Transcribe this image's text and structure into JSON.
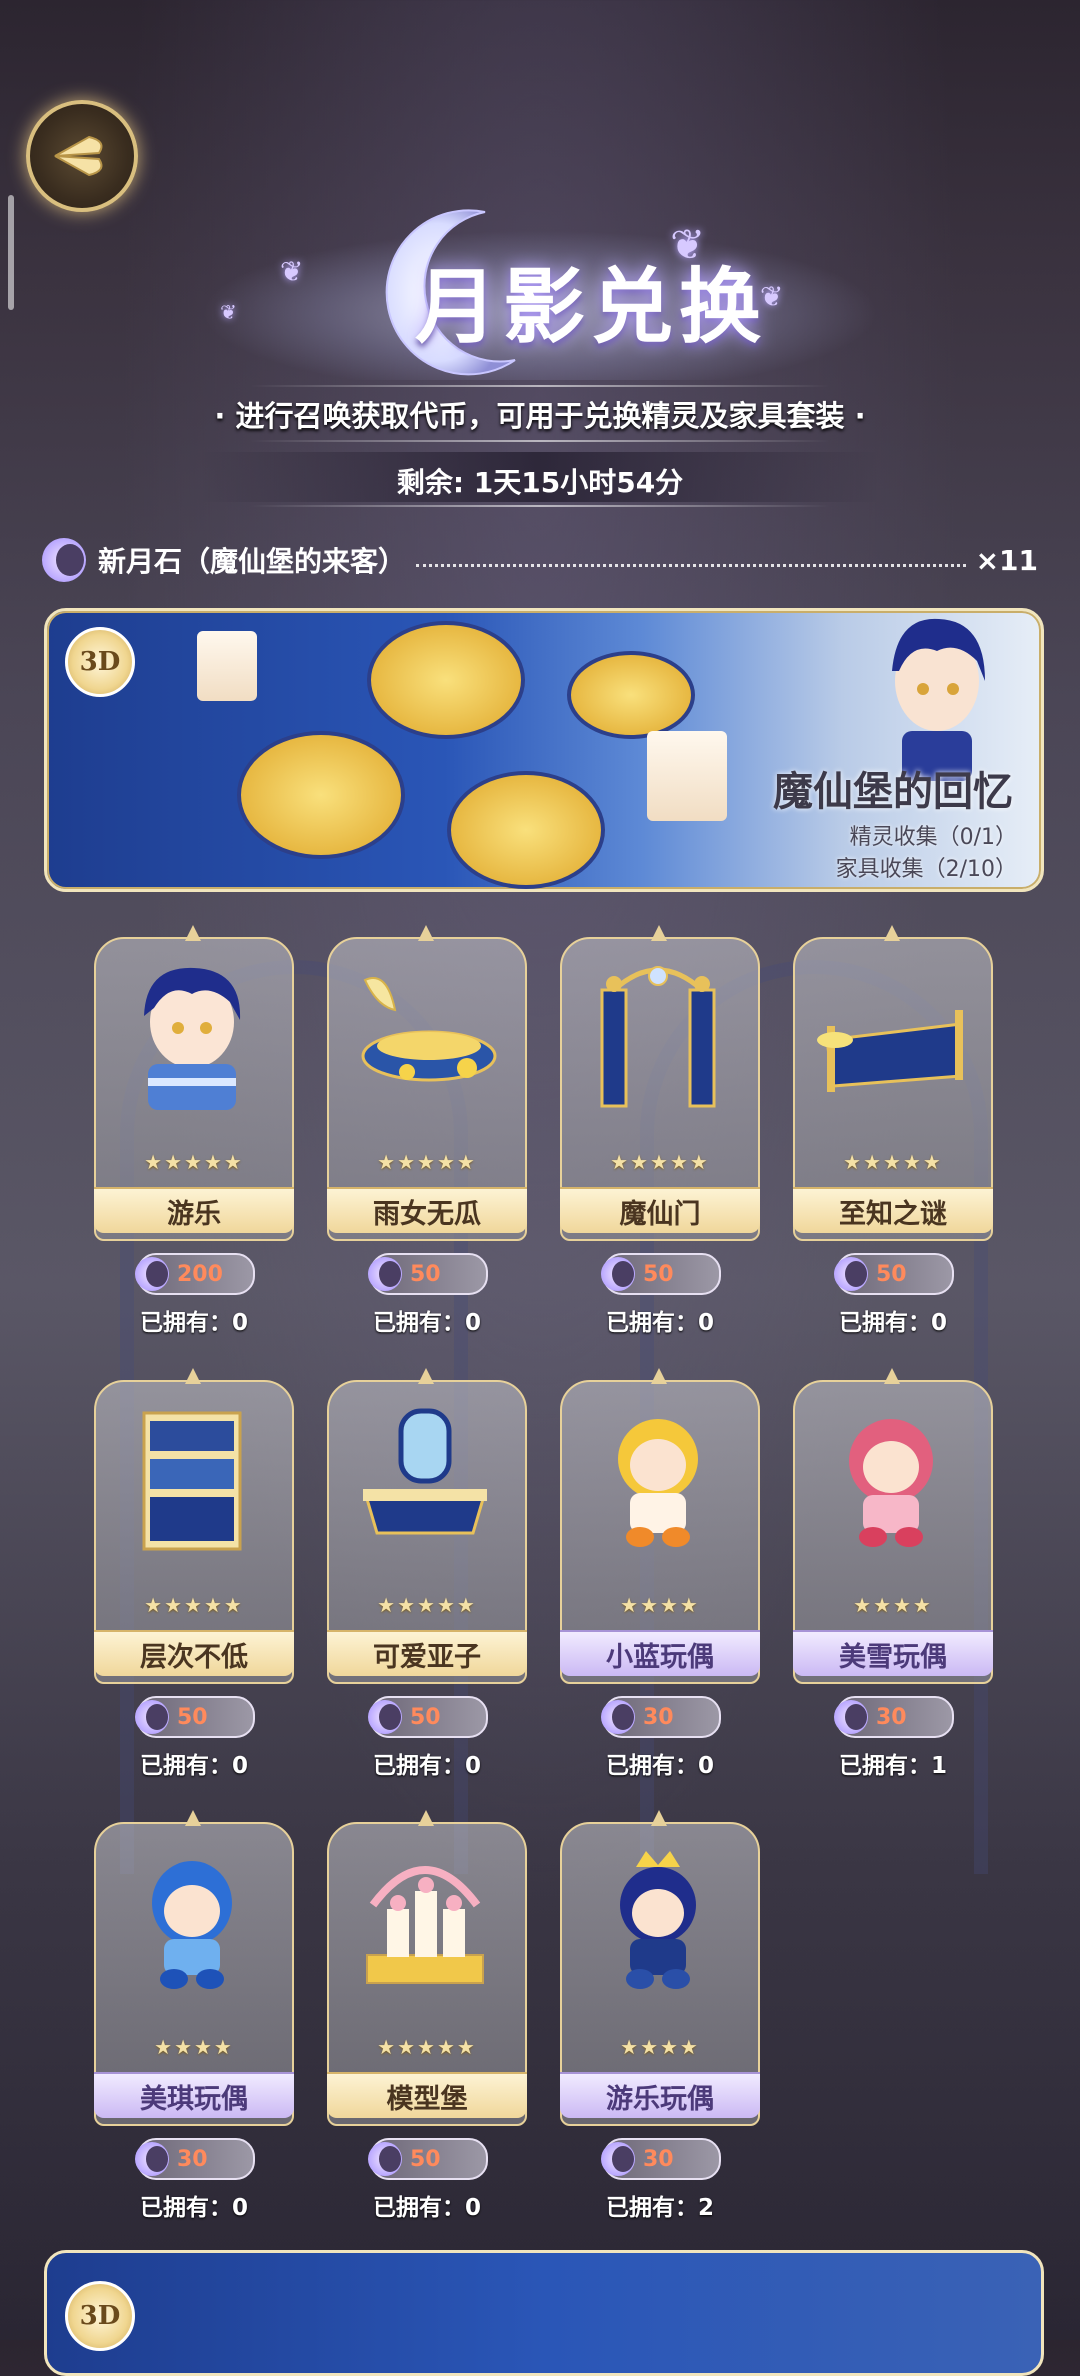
{
  "header": {
    "title": "月影兑换",
    "subtitle": "· 进行召唤获取代币，可用于兑换精灵及家具套装 ·",
    "timer": "剩余: 1天15小时54分"
  },
  "currency": {
    "name": "新月石（魔仙堡的来客）",
    "count": "×11",
    "icon": "moon-stone-icon"
  },
  "banner": {
    "badge": "3D",
    "title": "魔仙堡的回忆",
    "sprite_collect": "精灵收集（0/1）",
    "furniture_collect": "家具收集（2/10）"
  },
  "items": [
    {
      "name": "游乐",
      "stars": "★★★★★",
      "price": "200",
      "owned": "已拥有：0",
      "plate": "gold"
    },
    {
      "name": "雨女无瓜",
      "stars": "★★★★★",
      "price": "50",
      "owned": "已拥有：0",
      "plate": "gold"
    },
    {
      "name": "魔仙门",
      "stars": "★★★★★",
      "price": "50",
      "owned": "已拥有：0",
      "plate": "gold"
    },
    {
      "name": "至知之谜",
      "stars": "★★★★★",
      "price": "50",
      "owned": "已拥有：0",
      "plate": "gold"
    },
    {
      "name": "层次不低",
      "stars": "★★★★★",
      "price": "50",
      "owned": "已拥有：0",
      "plate": "gold"
    },
    {
      "name": "可爱亚子",
      "stars": "★★★★★",
      "price": "50",
      "owned": "已拥有：0",
      "plate": "gold"
    },
    {
      "name": "小蓝玩偶",
      "stars": "★★★★",
      "price": "30",
      "owned": "已拥有：0",
      "plate": "purple"
    },
    {
      "name": "美雪玩偶",
      "stars": "★★★★",
      "price": "30",
      "owned": "已拥有：1",
      "plate": "purple"
    },
    {
      "name": "美琪玩偶",
      "stars": "★★★★",
      "price": "30",
      "owned": "已拥有：0",
      "plate": "purple"
    },
    {
      "name": "模型堡",
      "stars": "★★★★★",
      "price": "50",
      "owned": "已拥有：0",
      "plate": "gold"
    },
    {
      "name": "游乐玩偶",
      "stars": "★★★★",
      "price": "30",
      "owned": "已拥有：2",
      "plate": "purple"
    }
  ],
  "bottom_banner": {
    "badge": "3D"
  },
  "colors": {
    "price_text": "#ff8a5c",
    "gold_trim": "#e7d19a",
    "banner_blue": "#2a56b7"
  }
}
